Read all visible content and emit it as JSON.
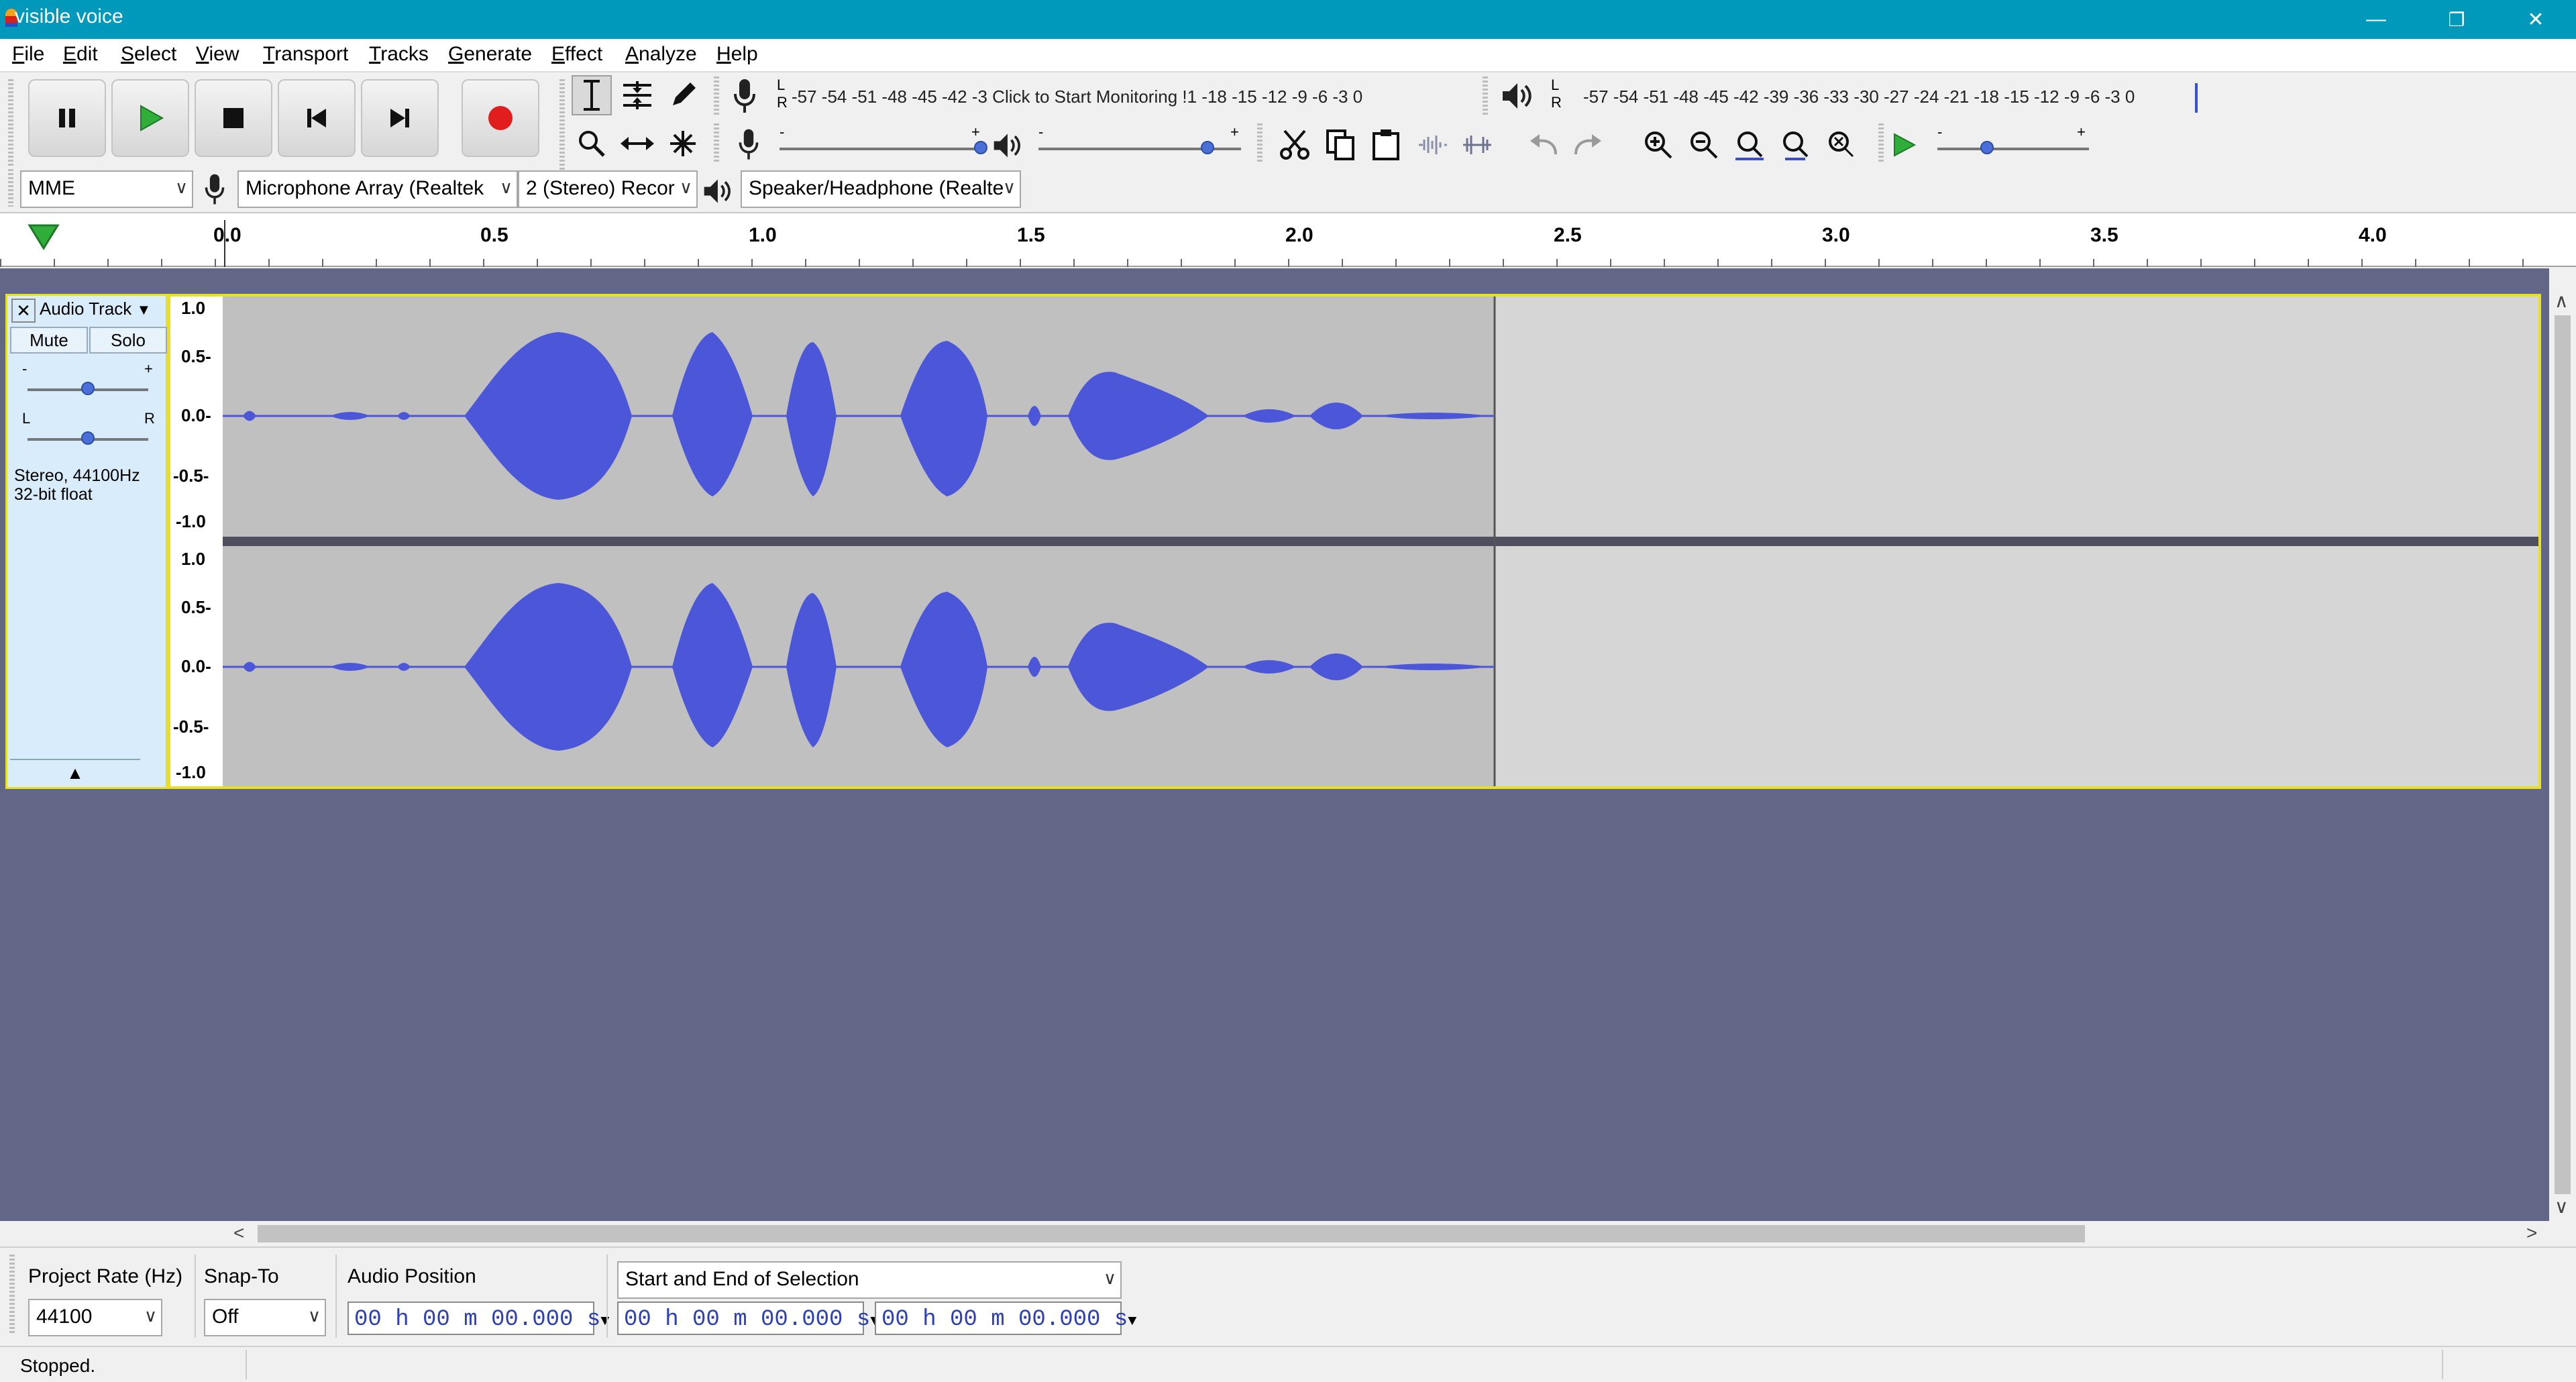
{
  "window": {
    "title": "visible voice"
  },
  "menu": [
    "File",
    "Edit",
    "Select",
    "View",
    "Transport",
    "Tracks",
    "Generate",
    "Effect",
    "Analyze",
    "Help"
  ],
  "meters": {
    "record_scale": "-57 -54 -51 -48 -45 -42 -3",
    "record_prompt": "Click to Start Monitoring",
    "record_scale_tail": "!1 -18 -15 -12 -9 -6 -3 0",
    "playback_scale": "-57 -54 -51 -48 -45 -42 -39 -36 -33 -30 -27 -24 -21 -18 -15 -12 -9 -6 -3 0",
    "lr": [
      "L",
      "R"
    ]
  },
  "slider_signs": {
    "minus": "-",
    "plus": "+"
  },
  "device": {
    "host": "MME",
    "input": "Microphone Array (Realtek",
    "channels": "2 (Stereo) Recor",
    "output": "Speaker/Headphone (Realte"
  },
  "ruler": {
    "labels": [
      "0.0",
      "0.5",
      "1.0",
      "1.5",
      "2.0",
      "2.5",
      "3.0",
      "3.5",
      "4.0"
    ]
  },
  "track": {
    "name": "Audio Track",
    "mute": "Mute",
    "solo": "Solo",
    "gain_minus": "-",
    "gain_plus": "+",
    "pan_left": "L",
    "pan_right": "R",
    "info_line1": "Stereo, 44100Hz",
    "info_line2": "32-bit float",
    "scale": [
      "1.0",
      "0.5-",
      "0.0-",
      "-0.5-",
      "-1.0"
    ]
  },
  "bottom": {
    "project_rate_label": "Project Rate (Hz)",
    "project_rate": "44100",
    "snap_label": "Snap-To",
    "snap_value": "Off",
    "audio_position_label": "Audio Position",
    "audio_position": "00 h 00 m 00.000 s",
    "selection_mode": "Start and End of Selection",
    "sel_start": "00 h 00 m 00.000 s",
    "sel_end": "00 h 00 m 00.000 s"
  },
  "status": {
    "text": "Stopped."
  },
  "colors": {
    "titlebar": "#0099bc",
    "waveform": "#4b57d8",
    "track_bg": "#636787",
    "selection_outline": "#e9e020"
  }
}
